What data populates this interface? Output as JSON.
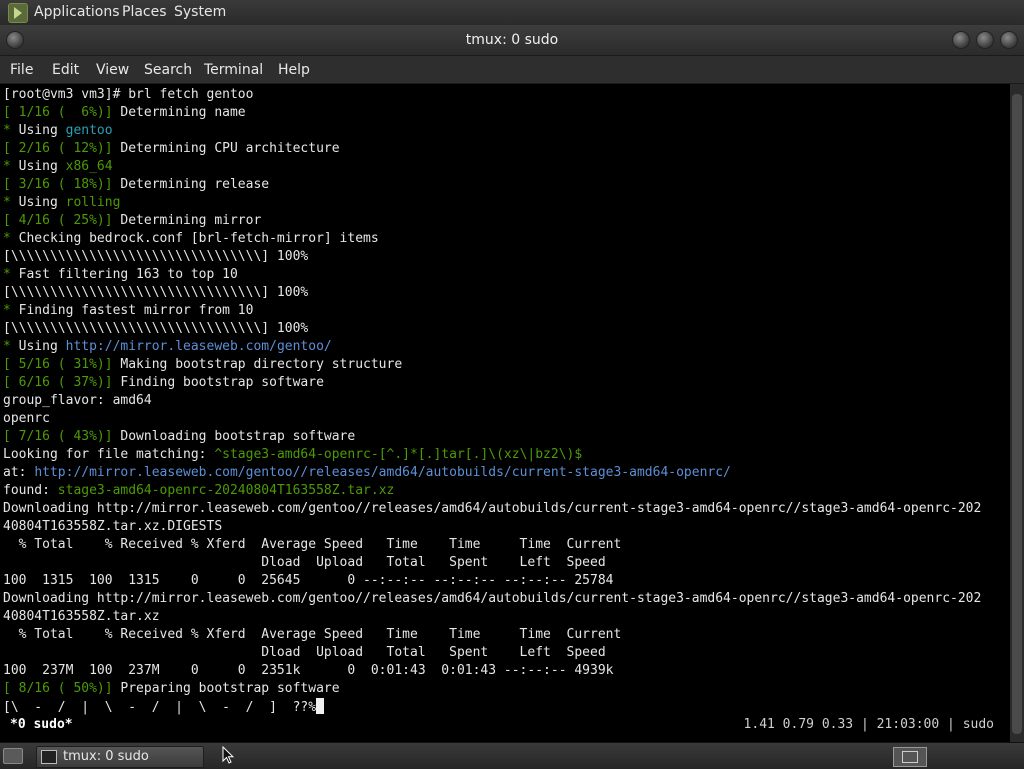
{
  "top_panel": {
    "menus": [
      "Applications",
      "Places",
      "System"
    ]
  },
  "window": {
    "title": "tmux: 0 sudo"
  },
  "menubar": {
    "items": [
      "File",
      "Edit",
      "View",
      "Search",
      "Terminal",
      "Help"
    ]
  },
  "terminal": {
    "lines": [
      [
        {
          "t": "[root@vm3 vm3]# brl fetch gentoo"
        }
      ],
      [
        {
          "t": "[ 1/16 (  6%)]",
          "c": "green"
        },
        {
          "t": " Determining name"
        }
      ],
      [
        {
          "t": "*",
          "c": "star"
        },
        {
          "t": " Using "
        },
        {
          "t": "gentoo",
          "c": "teal"
        }
      ],
      [
        {
          "t": "[ 2/16 ( 12%)]",
          "c": "green"
        },
        {
          "t": " Determining CPU architecture"
        }
      ],
      [
        {
          "t": "*",
          "c": "star"
        },
        {
          "t": " Using "
        },
        {
          "t": "x86_64",
          "c": "green"
        }
      ],
      [
        {
          "t": "[ 3/16 ( 18%)]",
          "c": "green"
        },
        {
          "t": " Determining release"
        }
      ],
      [
        {
          "t": "*",
          "c": "star"
        },
        {
          "t": " Using "
        },
        {
          "t": "rolling",
          "c": "green"
        }
      ],
      [
        {
          "t": "[ 4/16 ( 25%)]",
          "c": "green"
        },
        {
          "t": " Determining mirror"
        }
      ],
      [
        {
          "t": "*",
          "c": "star"
        },
        {
          "t": " Checking bedrock.conf [brl-fetch-mirror] items"
        }
      ],
      [
        {
          "t": "[\\\\\\\\\\\\\\\\\\\\\\\\\\\\\\\\\\\\\\\\\\\\\\\\\\\\\\\\\\\\\\\\] 100%"
        }
      ],
      [
        {
          "t": "*",
          "c": "star"
        },
        {
          "t": " Fast filtering 163 to top 10"
        }
      ],
      [
        {
          "t": "[\\\\\\\\\\\\\\\\\\\\\\\\\\\\\\\\\\\\\\\\\\\\\\\\\\\\\\\\\\\\\\\\] 100%"
        }
      ],
      [
        {
          "t": "*",
          "c": "star"
        },
        {
          "t": " Finding fastest mirror from 10"
        }
      ],
      [
        {
          "t": "[\\\\\\\\\\\\\\\\\\\\\\\\\\\\\\\\\\\\\\\\\\\\\\\\\\\\\\\\\\\\\\\\] 100%"
        }
      ],
      [
        {
          "t": "*",
          "c": "star"
        },
        {
          "t": " Using "
        },
        {
          "t": "http://mirror.leaseweb.com/gentoo/",
          "c": "blue"
        }
      ],
      [
        {
          "t": "[ 5/16 ( 31%)]",
          "c": "green"
        },
        {
          "t": " Making bootstrap directory structure"
        }
      ],
      [
        {
          "t": "[ 6/16 ( 37%)]",
          "c": "green"
        },
        {
          "t": " Finding bootstrap software"
        }
      ],
      [
        {
          "t": "group_flavor: amd64"
        }
      ],
      [
        {
          "t": "openrc"
        }
      ],
      [
        {
          "t": "[ 7/16 ( 43%)]",
          "c": "green"
        },
        {
          "t": " Downloading bootstrap software"
        }
      ],
      [
        {
          "t": "Looking for file matching: "
        },
        {
          "t": "^stage3-amd64-openrc-[^.]*[.]tar[.]\\(xz\\|bz2\\)$",
          "c": "green"
        }
      ],
      [
        {
          "t": "at: "
        },
        {
          "t": "http://mirror.leaseweb.com/gentoo//releases/amd64/autobuilds/current-stage3-amd64-openrc/",
          "c": "blue"
        }
      ],
      [
        {
          "t": "found: "
        },
        {
          "t": "stage3-amd64-openrc-20240804T163558Z.tar.xz",
          "c": "green"
        }
      ],
      [
        {
          "t": "Downloading http://mirror.leaseweb.com/gentoo//releases/amd64/autobuilds/current-stage3-amd64-openrc//stage3-amd64-openrc-202"
        }
      ],
      [
        {
          "t": "40804T163558Z.tar.xz.DIGESTS"
        }
      ],
      [
        {
          "t": "  % Total    % Received % Xferd  Average Speed   Time    Time     Time  Current"
        }
      ],
      [
        {
          "t": "                                 Dload  Upload   Total   Spent    Left  Speed"
        }
      ],
      [
        {
          "t": "100  1315  100  1315    0     0  25645      0 --:--:-- --:--:-- --:--:-- 25784"
        }
      ],
      [
        {
          "t": "Downloading http://mirror.leaseweb.com/gentoo//releases/amd64/autobuilds/current-stage3-amd64-openrc//stage3-amd64-openrc-202"
        }
      ],
      [
        {
          "t": "40804T163558Z.tar.xz"
        }
      ],
      [
        {
          "t": "  % Total    % Received % Xferd  Average Speed   Time    Time     Time  Current"
        }
      ],
      [
        {
          "t": "                                 Dload  Upload   Total   Spent    Left  Speed"
        }
      ],
      [
        {
          "t": "100  237M  100  237M    0     0  2351k      0  0:01:43  0:01:43 --:--:-- 4939k"
        }
      ],
      [
        {
          "t": "[ 8/16 ( 50%)]",
          "c": "green"
        },
        {
          "t": " Preparing bootstrap software"
        }
      ],
      [
        {
          "t": "[\\  -  /  |  \\  -  /  |  \\  -  /  ]  ??%"
        },
        {
          "cursor": true
        }
      ]
    ]
  },
  "tmux_status": {
    "left": "*0 sudo*",
    "right": "1.41 0.79 0.33 | 21:03:00 | sudo"
  },
  "taskbar": {
    "button_label": "tmux: 0 sudo"
  },
  "colors": {
    "green": "#4e9a06",
    "teal": "#2aa1b3",
    "blue": "#5c8fd6"
  }
}
